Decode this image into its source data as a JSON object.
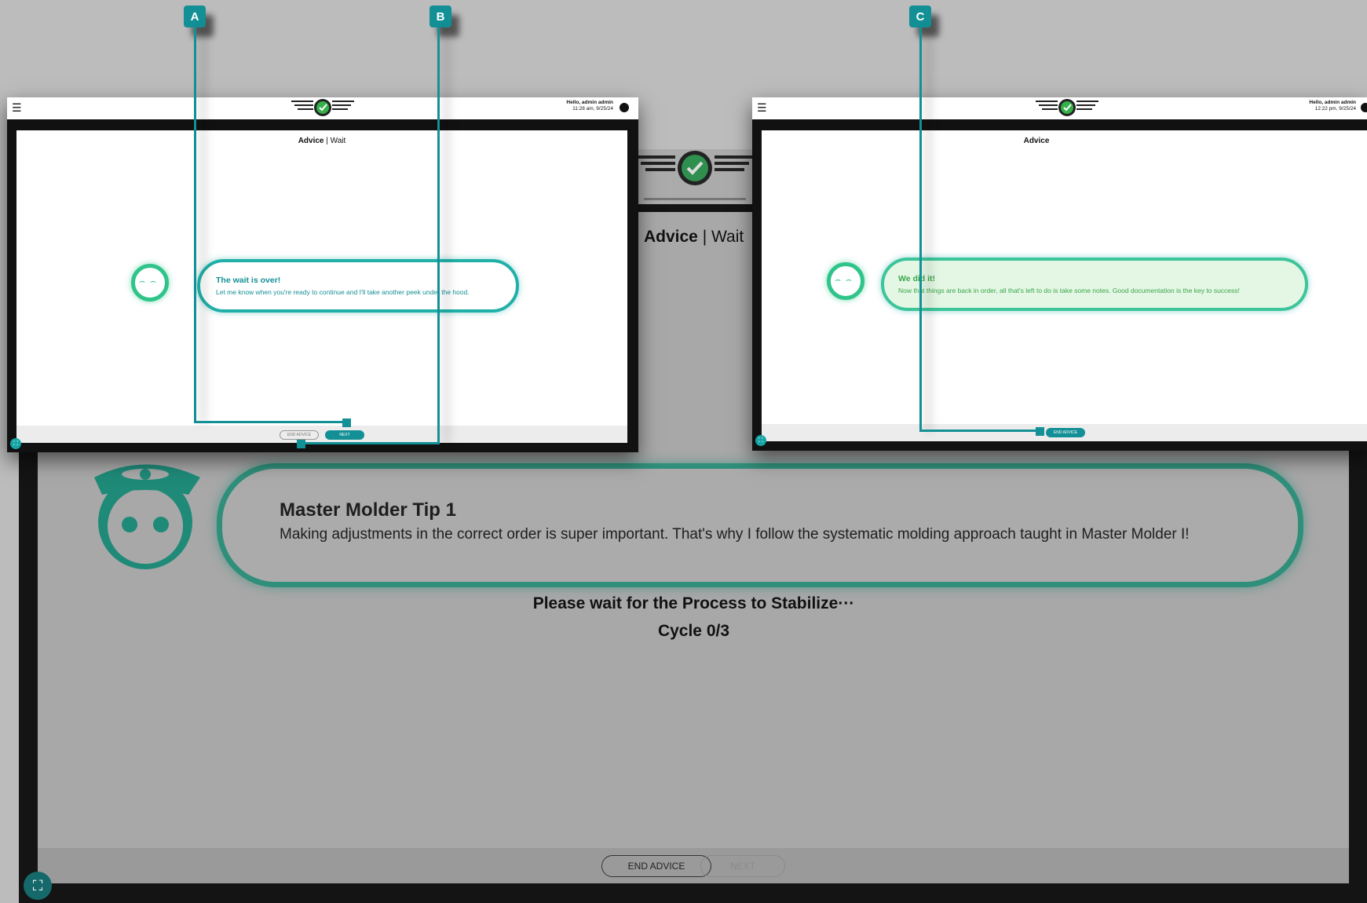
{
  "background_screen": {
    "title_bold": "Advice",
    "title_rest": " | Wait",
    "tip_title": "Master Molder Tip 1",
    "tip_text": "Making adjustments in the correct order is super important. That's why I follow the systematic molding approach taught in Master Molder I!",
    "wait_text": "Please wait for the Process to Stabilize···",
    "cycle_text": "Cycle 0/3",
    "end_advice_label": "END ADVICE",
    "next_label": "NEXT"
  },
  "panel_left": {
    "greeting": "Hello, admin admin",
    "timestamp": "11:28 am, 9/25/24",
    "title_bold": "Advice",
    "title_rest": " | Wait",
    "bubble_title": "The wait is over!",
    "bubble_text": "Let me know when you're ready to continue and I'll take another peek under the hood.",
    "end_advice_label": "END ADVICE",
    "next_label": "NEXT"
  },
  "panel_right": {
    "greeting": "Hello, admin admin",
    "timestamp": "12:22 pm, 9/25/24",
    "title_bold": "Advice",
    "bubble_title": "We did it!",
    "bubble_text": "Now that things are back in order, all that's left to do is take some notes. Good documentation is the key to success!",
    "end_advice_label": "END ADVICE"
  },
  "callouts": {
    "a": "A",
    "b": "B",
    "c": "C"
  },
  "icons": {
    "menu": "hamburger-menu-icon",
    "user": "user-account-icon",
    "expand": "expand-fullscreen-icon",
    "logo": "winged-checkmark-logo"
  },
  "colors": {
    "teal": "#138f96",
    "green": "#2fc48a",
    "success_fill": "#e4f7e4",
    "success_text": "#3aa64a"
  }
}
